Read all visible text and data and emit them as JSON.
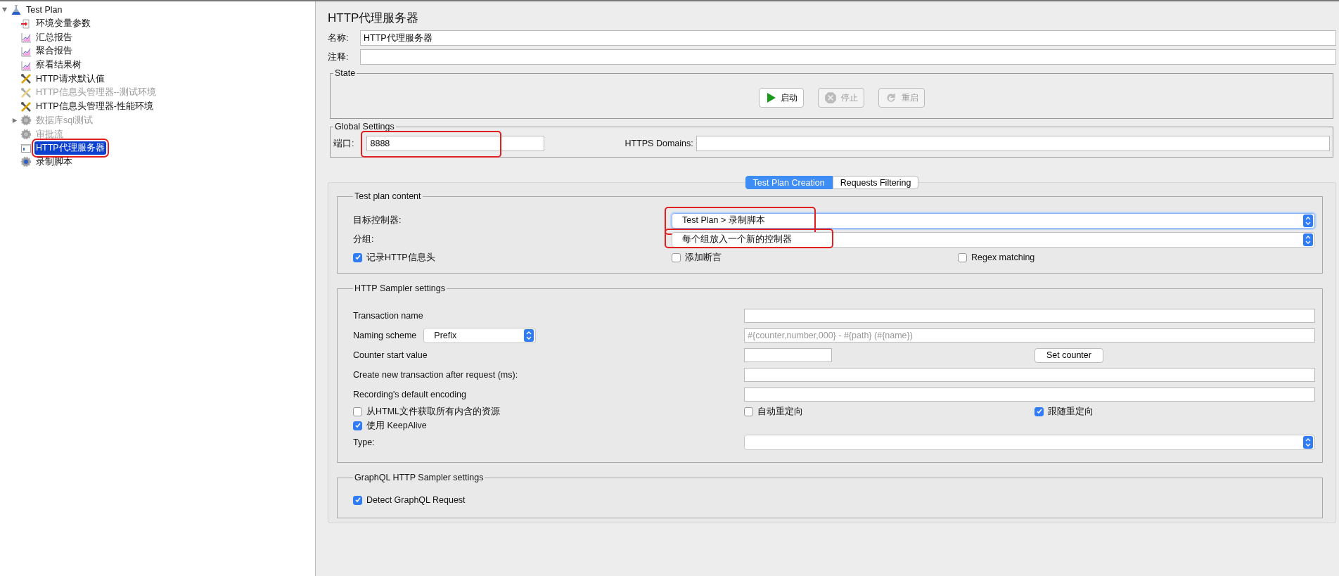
{
  "tree": {
    "label": "Test Plan",
    "expanded": true,
    "children": [
      {
        "label": "环境变量参数",
        "kind": "config",
        "disabled": false,
        "selected": false,
        "annotated": false
      },
      {
        "label": "汇总报告",
        "kind": "graph",
        "disabled": false,
        "selected": false,
        "annotated": false
      },
      {
        "label": "聚合报告",
        "kind": "graph",
        "disabled": false,
        "selected": false,
        "annotated": false
      },
      {
        "label": "察看结果树",
        "kind": "graph",
        "disabled": false,
        "selected": false,
        "annotated": false
      },
      {
        "label": "HTTP请求默认值",
        "kind": "tools",
        "disabled": false,
        "selected": false,
        "annotated": false
      },
      {
        "label": "HTTP信息头管理器--测试环境",
        "kind": "tools",
        "disabled": true,
        "selected": false,
        "annotated": false
      },
      {
        "label": "HTTP信息头管理器-性能环境",
        "kind": "tools",
        "disabled": false,
        "selected": false,
        "annotated": false
      },
      {
        "label": "数据库sql测试",
        "kind": "gear",
        "disabled": true,
        "selected": false,
        "annotated": false,
        "expanded": false
      },
      {
        "label": "审批流",
        "kind": "gear",
        "disabled": true,
        "selected": false,
        "annotated": false
      },
      {
        "label": "HTTP代理服务器",
        "kind": "proxy",
        "disabled": false,
        "selected": true,
        "annotated": true
      },
      {
        "label": "录制脚本",
        "kind": "script",
        "disabled": false,
        "selected": false,
        "annotated": false
      }
    ]
  },
  "title": "HTTP代理服务器",
  "name_field": {
    "label": "名称:",
    "value": "HTTP代理服务器"
  },
  "comment_field": {
    "label": "注释:"
  },
  "state": {
    "title": "State",
    "buttons": [
      {
        "label": "启动",
        "kind": "start",
        "disabled": false
      },
      {
        "label": "停止",
        "kind": "stop",
        "disabled": true
      },
      {
        "label": "重启",
        "kind": "restart",
        "disabled": true
      }
    ]
  },
  "global_settings": {
    "title": "Global Settings",
    "port": {
      "label": "端口:",
      "value": "8888",
      "annotated": true
    },
    "https_domains": {
      "label": "HTTPS Domains:"
    }
  },
  "tabs": [
    {
      "label": "Test Plan Creation",
      "selected": true
    },
    {
      "label": "Requests Filtering",
      "selected": false
    }
  ],
  "test_plan_content": {
    "title": "Test plan content",
    "target_controller": {
      "label": "目标控制器:",
      "value": "Test Plan > 录制脚本",
      "annotated": true
    },
    "grouping": {
      "label": "分组:",
      "value": "每个组放入一个新的控制器",
      "annotated": true
    },
    "checkboxes": [
      {
        "label": "记录HTTP信息头",
        "checked": true
      },
      {
        "label": "添加断言",
        "checked": false
      },
      {
        "label": "Regex matching",
        "checked": false
      }
    ]
  },
  "sampler_settings": {
    "title": "HTTP Sampler settings",
    "transaction_name": {
      "label": "Transaction name"
    },
    "naming_scheme": {
      "label": "Naming scheme",
      "value": "Prefix",
      "format": "#{counter,number,000} - #{path} (#{name})",
      "format_disabled": true
    },
    "counter_start": {
      "label": "Counter start value",
      "button": "Set counter"
    },
    "new_transaction": {
      "label": "Create new transaction after request (ms):"
    },
    "encoding": {
      "label": "Recording's default encoding"
    },
    "checkbox_rows": [
      [
        {
          "label": "从HTML文件获取所有内含的资源",
          "checked": false
        },
        {
          "label": "自动重定向",
          "checked": false
        },
        {
          "label": "跟随重定向",
          "checked": true
        }
      ],
      [
        {
          "label": "使用 KeepAlive",
          "checked": true
        }
      ]
    ],
    "type": {
      "label": "Type:"
    }
  },
  "graphql": {
    "title": "GraphQL HTTP Sampler settings",
    "checkboxes": [
      {
        "label": "Detect GraphQL Request",
        "checked": true
      }
    ]
  }
}
